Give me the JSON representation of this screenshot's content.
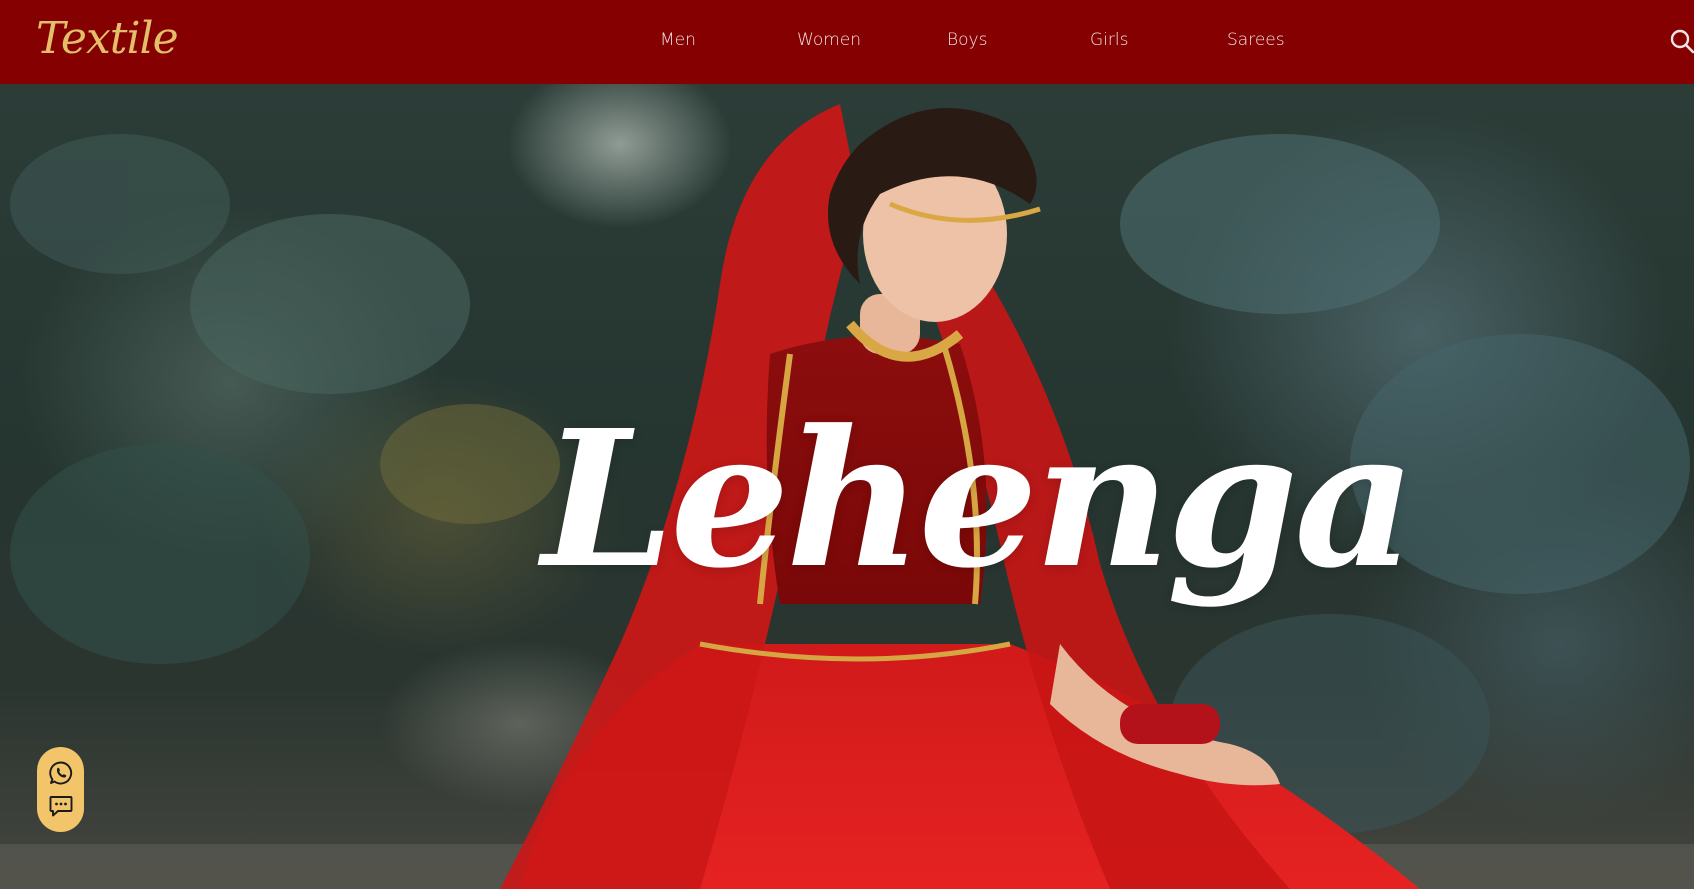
{
  "header": {
    "logo_text": "Textile",
    "nav": [
      {
        "label": "Men"
      },
      {
        "label": "Women"
      },
      {
        "label": "Boys"
      },
      {
        "label": "Girls"
      },
      {
        "label": "Sarees"
      }
    ],
    "search_icon": "search-icon"
  },
  "hero": {
    "title": "Lehenga",
    "image": "bride-in-red-lehenga-photo"
  },
  "contact_widget": {
    "buttons": [
      {
        "icon": "whatsapp-icon"
      },
      {
        "icon": "chat-icon"
      }
    ]
  },
  "colors": {
    "header_bg": "#850000",
    "logo": "#e3bf6a",
    "widget_bg": "#f3c56b",
    "hero_title": "#ffffff"
  }
}
